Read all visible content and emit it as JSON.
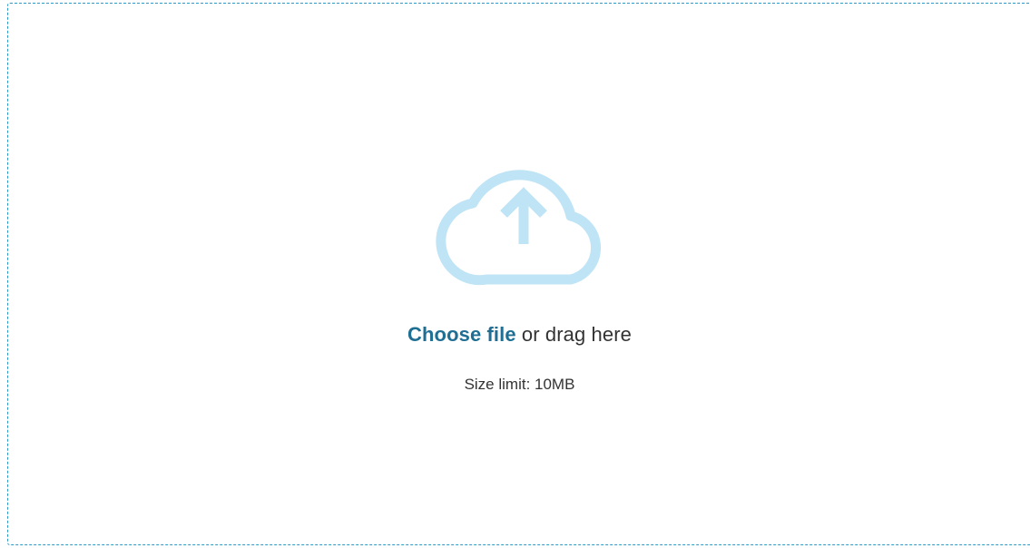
{
  "upload": {
    "choose_label": "Choose file",
    "drag_text": " or drag here",
    "size_limit": "Size limit: 10MB",
    "icon": "cloud-upload-icon"
  },
  "colors": {
    "border": "#2b9ac7",
    "icon": "#bfe4f5",
    "link": "#1e6f93",
    "text": "#333333"
  }
}
